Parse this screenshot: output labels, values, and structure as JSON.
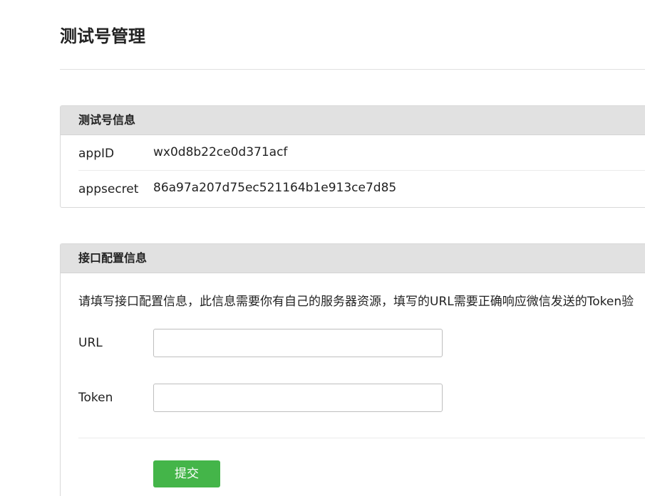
{
  "page": {
    "title": "测试号管理"
  },
  "test_account": {
    "header": "测试号信息",
    "rows": [
      {
        "label": "appID",
        "value": "wx0d8b22ce0d371acf"
      },
      {
        "label": "appsecret",
        "value": "86a97a207d75ec521164b1e913ce7d85"
      }
    ]
  },
  "interface_config": {
    "header": "接口配置信息",
    "description": "请填写接口配置信息，此信息需要你有自己的服务器资源，填写的URL需要正确响应微信发送的Token验",
    "url": {
      "label": "URL",
      "value": ""
    },
    "token": {
      "label": "Token",
      "value": ""
    },
    "submit_label": "提交"
  },
  "colors": {
    "accent": "#44b549",
    "panel_header_bg": "#e1e1e1"
  }
}
